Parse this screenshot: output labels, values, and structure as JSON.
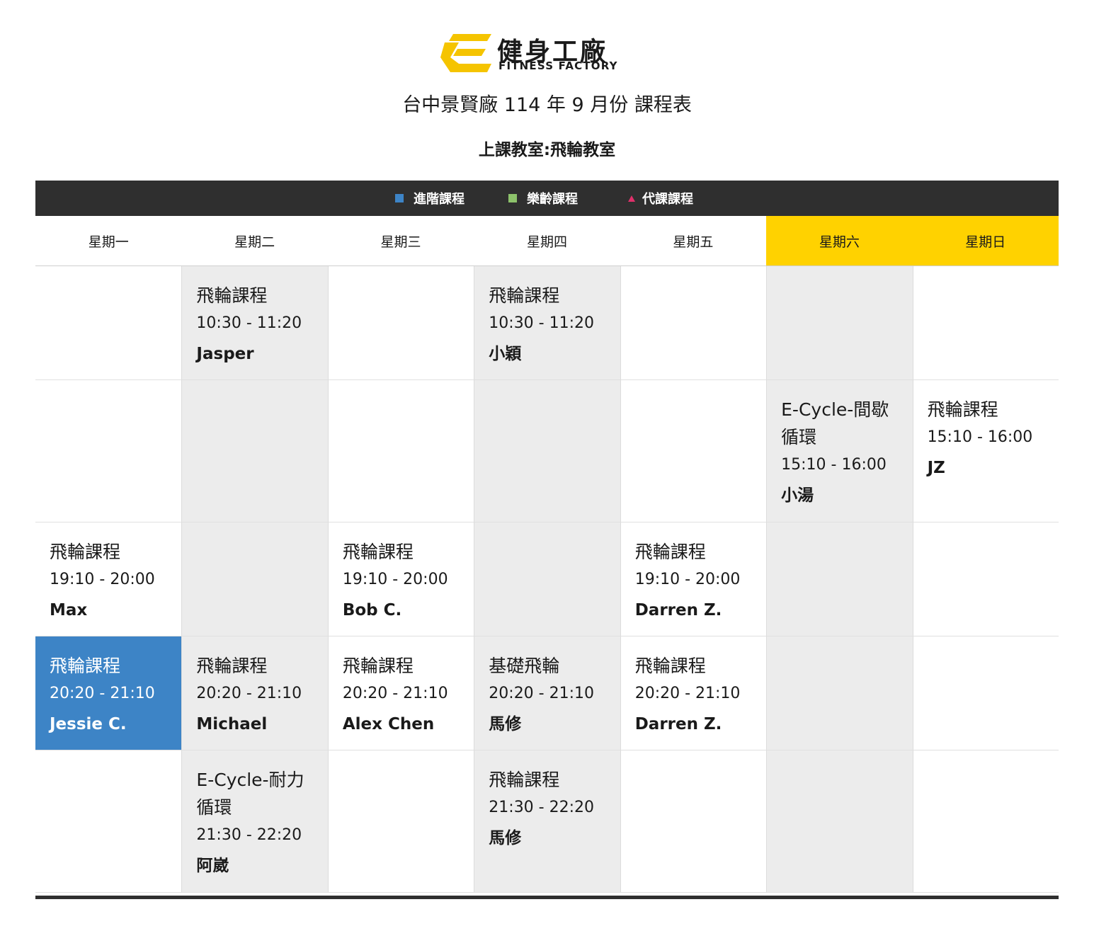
{
  "brand": {
    "name_cn": "健身工廠",
    "name_en": "FITNESS FACTORY",
    "logo_color": "#f5c400"
  },
  "title": "台中景賢廠 114 年 9 月份 課程表",
  "subtitle": "上課教室:飛輪教室",
  "legend": [
    {
      "label": "進階課程",
      "color": "#3d84c6",
      "shape": "square"
    },
    {
      "label": "樂齡課程",
      "color": "#8dc26b",
      "shape": "square"
    },
    {
      "label": "代課課程",
      "color": "#e0306a",
      "shape": "triangle"
    }
  ],
  "days": [
    "星期一",
    "星期二",
    "星期三",
    "星期四",
    "星期五",
    "星期六",
    "星期日"
  ],
  "colors": {
    "weekend": "#ffd200",
    "advanced": "#3d84c6",
    "gray_column": "#ececec",
    "header_bar": "#2f2f2f"
  },
  "rows": [
    [
      null,
      {
        "name": "飛輪課程",
        "time": "10:30 - 11:20",
        "coach": "Jasper"
      },
      null,
      {
        "name": "飛輪課程",
        "time": "10:30 - 11:20",
        "coach": "小穎"
      },
      null,
      null,
      null
    ],
    [
      null,
      null,
      null,
      null,
      null,
      {
        "name": "E-Cycle-間歇循環",
        "time": "15:10 - 16:00",
        "coach": "小湯"
      },
      {
        "name": "飛輪課程",
        "time": "15:10 - 16:00",
        "coach": "JZ"
      }
    ],
    [
      {
        "name": "飛輪課程",
        "time": "19:10 - 20:00",
        "coach": "Max"
      },
      null,
      {
        "name": "飛輪課程",
        "time": "19:10 - 20:00",
        "coach": "Bob C."
      },
      null,
      {
        "name": "飛輪課程",
        "time": "19:10 - 20:00",
        "coach": "Darren Z."
      },
      null,
      null
    ],
    [
      {
        "name": "飛輪課程",
        "time": "20:20 - 21:10",
        "coach": "Jessie C.",
        "type": "advanced"
      },
      {
        "name": "飛輪課程",
        "time": "20:20 - 21:10",
        "coach": "Michael"
      },
      {
        "name": "飛輪課程",
        "time": "20:20 - 21:10",
        "coach": "Alex Chen"
      },
      {
        "name": "基礎飛輪",
        "time": "20:20 - 21:10",
        "coach": "馬修"
      },
      {
        "name": "飛輪課程",
        "time": "20:20 - 21:10",
        "coach": "Darren Z."
      },
      null,
      null
    ],
    [
      null,
      {
        "name": "E-Cycle-耐力循環",
        "time": "21:30 - 22:20",
        "coach": "阿崴"
      },
      null,
      {
        "name": "飛輪課程",
        "time": "21:30 - 22:20",
        "coach": "馬修"
      },
      null,
      null,
      null
    ]
  ]
}
